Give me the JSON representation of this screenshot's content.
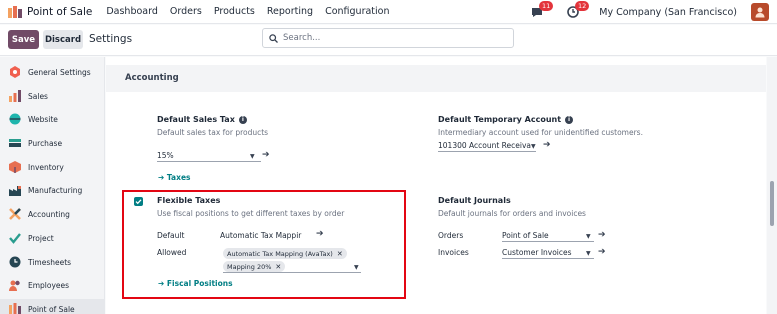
{
  "app": {
    "name": "Point of Sale"
  },
  "menu": [
    "Dashboard",
    "Orders",
    "Products",
    "Reporting",
    "Configuration"
  ],
  "topbar": {
    "messages_badge": "11",
    "activity_badge": "12",
    "company": "My Company (San Francisco)"
  },
  "controls": {
    "save": "Save",
    "discard": "Discard",
    "title": "Settings",
    "search_placeholder": "Search..."
  },
  "sidebar": {
    "items": [
      {
        "label": "General Settings",
        "icon": "general-settings-icon",
        "color": "#f06050"
      },
      {
        "label": "Sales",
        "icon": "sales-icon",
        "color": "#f4a261"
      },
      {
        "label": "Website",
        "icon": "website-icon",
        "color": "#1fb5ad"
      },
      {
        "label": "Purchase",
        "icon": "purchase-icon",
        "color": "#2a9d8f"
      },
      {
        "label": "Inventory",
        "icon": "inventory-icon",
        "color": "#e76f51"
      },
      {
        "label": "Manufacturing",
        "icon": "manufacturing-icon",
        "color": "#264653"
      },
      {
        "label": "Accounting",
        "icon": "accounting-icon",
        "color": "#f4a261"
      },
      {
        "label": "Project",
        "icon": "project-icon",
        "color": "#2a9d8f"
      },
      {
        "label": "Timesheets",
        "icon": "timesheets-icon",
        "color": "#264653"
      },
      {
        "label": "Employees",
        "icon": "employees-icon",
        "color": "#e76f51"
      },
      {
        "label": "Point of Sale",
        "icon": "point-of-sale-icon",
        "color": "#714b67"
      }
    ]
  },
  "section": {
    "title": "Accounting"
  },
  "default_sales_tax": {
    "title": "Default Sales Tax",
    "desc": "Default sales tax for products",
    "value": "15%",
    "link": "Taxes"
  },
  "default_temp_account": {
    "title": "Default Temporary Account",
    "desc": "Intermediary account used for unidentified customers.",
    "value": "101300 Account Receiva"
  },
  "flexible_taxes": {
    "title": "Flexible Taxes",
    "desc": "Use fiscal positions to get different taxes by order",
    "checked": true,
    "default_label": "Default",
    "default_value": "Automatic Tax Mappir",
    "allowed_label": "Allowed",
    "tags": [
      "Automatic Tax Mapping (AvaTax)",
      "Mapping 20%"
    ],
    "link": "Fiscal Positions"
  },
  "default_journals": {
    "title": "Default Journals",
    "desc": "Default journals for orders and invoices",
    "orders_label": "Orders",
    "orders_value": "Point of Sale",
    "invoices_label": "Invoices",
    "invoices_value": "Customer Invoices"
  },
  "colors": {
    "brand": "#714b67",
    "link": "#017e84",
    "highlight": "#e30613",
    "badge": "#e3343b"
  }
}
